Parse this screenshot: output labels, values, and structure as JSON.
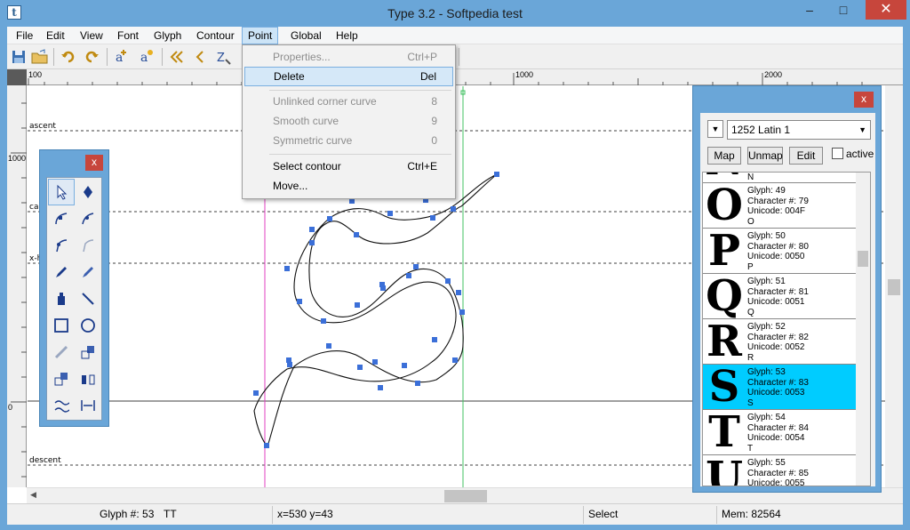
{
  "window": {
    "title": "Type 3.2  -  Softpedia test",
    "app_icon_letter": "t",
    "minimize": "–",
    "maximize": "□",
    "close": "✕"
  },
  "menubar": [
    "File",
    "Edit",
    "View",
    "Font",
    "Glyph",
    "Contour",
    "Point",
    "Global",
    "Help"
  ],
  "ruler": {
    "h": [
      "100",
      "1000",
      "2000"
    ],
    "v": [
      "1000",
      "0"
    ]
  },
  "guides": [
    "ascent",
    "cap",
    "x-h",
    "descent"
  ],
  "point_menu": {
    "items": [
      {
        "label": "Properties...",
        "shortcut": "Ctrl+P",
        "disabled": true
      },
      {
        "label": "Delete",
        "shortcut": "Del",
        "highlighted": true
      },
      {
        "label": "Unlinked corner curve",
        "shortcut": "8",
        "disabled": true
      },
      {
        "label": "Smooth curve",
        "shortcut": "9",
        "disabled": true
      },
      {
        "label": "Symmetric curve",
        "shortcut": "0",
        "disabled": true
      },
      {
        "label": "Select contour",
        "shortcut": "Ctrl+E"
      },
      {
        "label": "Move...",
        "shortcut": ""
      }
    ]
  },
  "char_panel": {
    "close": "x",
    "codepage": "1252 Latin 1",
    "buttons": {
      "map": "Map",
      "unmap": "Unmap",
      "edit": "Edit"
    },
    "active_label": "active",
    "top_partial": {
      "char": "N"
    },
    "glyphs": [
      {
        "glyph": "Glyph: 49",
        "character": "Character #: 79",
        "unicode": "Unicode: 004F",
        "char": "O",
        "big": "O"
      },
      {
        "glyph": "Glyph: 50",
        "character": "Character #: 80",
        "unicode": "Unicode: 0050",
        "char": "P",
        "big": "P"
      },
      {
        "glyph": "Glyph: 51",
        "character": "Character #: 81",
        "unicode": "Unicode: 0051",
        "char": "Q",
        "big": "Q"
      },
      {
        "glyph": "Glyph: 52",
        "character": "Character #: 82",
        "unicode": "Unicode: 0052",
        "char": "R",
        "big": "R"
      },
      {
        "glyph": "Glyph: 53",
        "character": "Character #: 83",
        "unicode": "Unicode: 0053",
        "char": "S",
        "big": "S",
        "selected": true
      },
      {
        "glyph": "Glyph: 54",
        "character": "Character #: 84",
        "unicode": "Unicode: 0054",
        "char": "T",
        "big": "T"
      },
      {
        "glyph": "Glyph: 55",
        "character": "Character #: 85",
        "unicode": "Unicode: 0055",
        "char": "U",
        "big": "U"
      }
    ]
  },
  "tool_palette": {
    "close": "x"
  },
  "status": {
    "glyph": "Glyph #: 53",
    "mode": "TT",
    "coords": "x=530  y=43",
    "tool": "Select",
    "memory": "Mem: 82564"
  },
  "colors": {
    "accent": "#6aa6d8",
    "selection": "#00ccff",
    "point": "#3b6fd8",
    "guide_magenta": "#e040c0",
    "guide_green": "#40c060"
  }
}
